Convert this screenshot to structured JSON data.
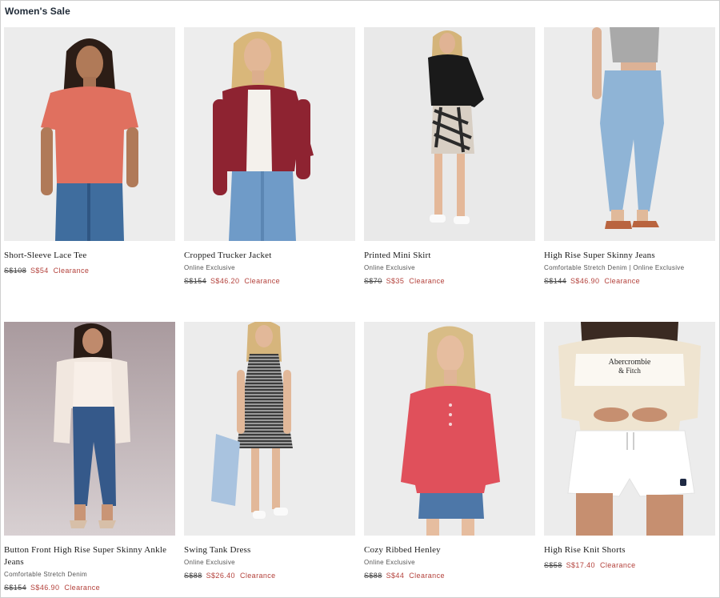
{
  "page": {
    "title": "Women's Sale"
  },
  "colors": {
    "sale": "#b3403a",
    "text": "#1b1b1b",
    "muted": "#555555"
  },
  "products": [
    {
      "name": "Short-Sleeve Lace Tee",
      "subtitle": "",
      "original_price": "S$108",
      "sale_price": "S$54",
      "badge": "Clearance",
      "image": "model-lace-tee-photo"
    },
    {
      "name": "Cropped Trucker Jacket",
      "subtitle": "Online Exclusive",
      "original_price": "S$154",
      "sale_price": "S$46.20",
      "badge": "Clearance",
      "image": "model-trucker-jacket-photo"
    },
    {
      "name": "Printed Mini Skirt",
      "subtitle": "Online Exclusive",
      "original_price": "S$70",
      "sale_price": "S$35",
      "badge": "Clearance",
      "image": "model-mini-skirt-photo"
    },
    {
      "name": "High Rise Super Skinny Jeans",
      "subtitle": "Comfortable Stretch Denim | Online Exclusive",
      "original_price": "S$144",
      "sale_price": "S$46.90",
      "badge": "Clearance",
      "image": "model-skinny-jeans-photo"
    },
    {
      "name": "Button Front High Rise Super Skinny Ankle Jeans",
      "subtitle": "Comfortable Stretch Denim",
      "original_price": "S$154",
      "sale_price": "S$46.90",
      "badge": "Clearance",
      "image": "model-ankle-jeans-photo"
    },
    {
      "name": "Swing Tank Dress",
      "subtitle": "Online Exclusive",
      "original_price": "S$88",
      "sale_price": "S$26.40",
      "badge": "Clearance",
      "image": "model-tank-dress-photo"
    },
    {
      "name": "Cozy Ribbed Henley",
      "subtitle": "Online Exclusive",
      "original_price": "S$88",
      "sale_price": "S$44",
      "badge": "Clearance",
      "image": "model-henley-photo"
    },
    {
      "name": "High Rise Knit Shorts",
      "subtitle": "",
      "original_price": "S$58",
      "sale_price": "S$17.40",
      "badge": "Clearance",
      "image": "model-knit-shorts-photo",
      "logo_text": "Abercrombie & Fitch"
    }
  ]
}
